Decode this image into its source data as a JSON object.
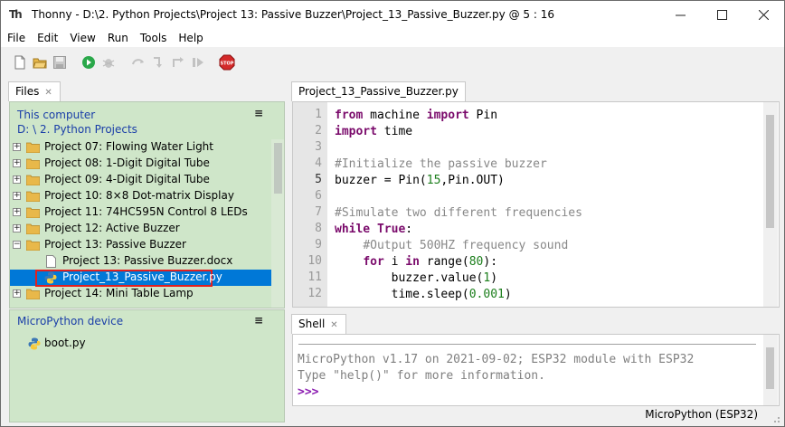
{
  "window": {
    "title": "Thonny  -  D:\\2. Python Projects\\Project 13:  Passive Buzzer\\Project_13_Passive_Buzzer.py  @  5 : 16"
  },
  "menu": [
    "File",
    "Edit",
    "View",
    "Run",
    "Tools",
    "Help"
  ],
  "toolbar": {
    "icons": [
      "new-file",
      "open-file",
      "save",
      "run",
      "debug",
      "step-over",
      "step-into",
      "step-out",
      "resume",
      "stop"
    ],
    "stop_label": "STOP"
  },
  "files_panel": {
    "tab_label": "Files",
    "location_title": "This computer",
    "location_path": "D: \\ 2. Python Projects",
    "tree": [
      {
        "label": "Project 07:  Flowing Water Light",
        "type": "folder",
        "expander": "+"
      },
      {
        "label": "Project 08:  1-Digit Digital Tube",
        "type": "folder",
        "expander": "+"
      },
      {
        "label": "Project 09:  4-Digit Digital Tube",
        "type": "folder",
        "expander": "+"
      },
      {
        "label": "Project 10:  8×8 Dot-matrix Display",
        "type": "folder",
        "expander": "+"
      },
      {
        "label": "Project 11:  74HC595N Control 8 LEDs",
        "type": "folder",
        "expander": "+"
      },
      {
        "label": "Project 12:  Active Buzzer",
        "type": "folder",
        "expander": "+"
      },
      {
        "label": "Project 13:  Passive Buzzer",
        "type": "folder",
        "expander": "−"
      },
      {
        "label": "Project 13:  Passive Buzzer.docx",
        "type": "file"
      },
      {
        "label": "Project_13_Passive_Buzzer.py",
        "type": "python",
        "selected": true
      },
      {
        "label": "Project 14:  Mini Table Lamp",
        "type": "folder",
        "expander": "+"
      }
    ]
  },
  "device_panel": {
    "title": "MicroPython device",
    "files": [
      "boot.py"
    ]
  },
  "editor": {
    "tab_label": "Project_13_Passive_Buzzer.py",
    "line_numbers": [
      "1",
      "2",
      "3",
      "4",
      "5",
      "6",
      "7",
      "8",
      "9",
      "10",
      "11",
      "12"
    ]
  },
  "shell": {
    "tab_label": "Shell",
    "line1": "MicroPython v1.17 on 2021-09-02; ESP32 module with ESP32",
    "line2": "Type \"help()\" for more information.",
    "prompt": ">>>"
  },
  "status": {
    "interpreter": "MicroPython (ESP32)"
  },
  "colors": {
    "panel_bg": "#cfe6c9",
    "selection": "#0078d7",
    "highlight_box": "#e02020",
    "keyword": "#7a0a6b",
    "comment": "#888888",
    "number": "#1b7e1b"
  }
}
